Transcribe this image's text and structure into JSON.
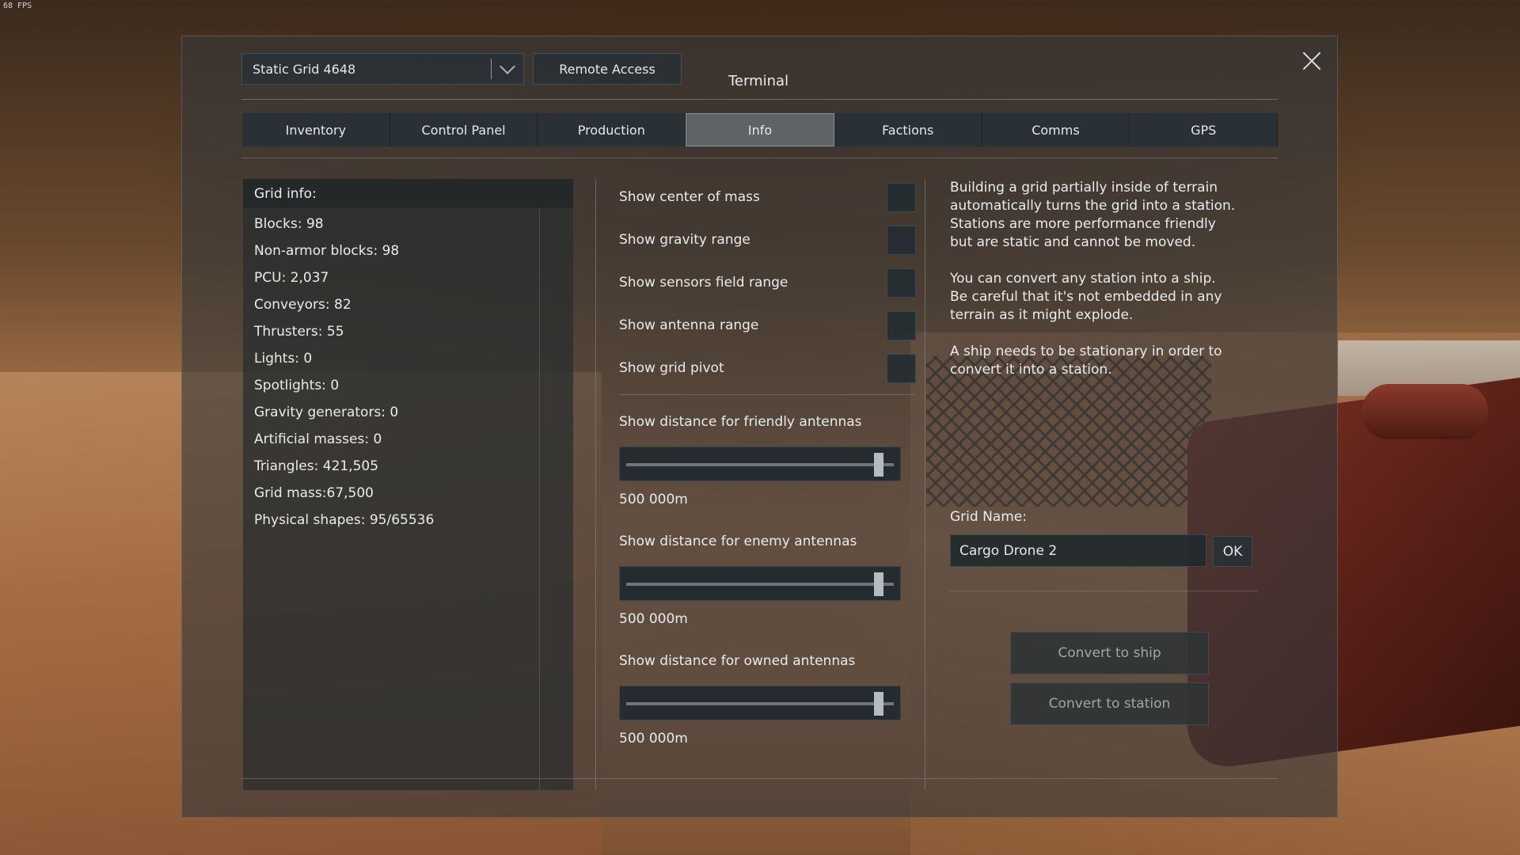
{
  "hud": {
    "fps": "68 FPS"
  },
  "terminal": {
    "title": "Terminal",
    "grid_selector": {
      "value": "Static Grid 4648"
    },
    "remote_access_label": "Remote Access",
    "close_icon": "close-icon"
  },
  "tabs": [
    {
      "label": "Inventory",
      "active": false
    },
    {
      "label": "Control Panel",
      "active": false
    },
    {
      "label": "Production",
      "active": false
    },
    {
      "label": "Info",
      "active": true
    },
    {
      "label": "Factions",
      "active": false
    },
    {
      "label": "Comms",
      "active": false
    },
    {
      "label": "GPS",
      "active": false
    }
  ],
  "grid_info": {
    "header": "Grid info:",
    "rows": [
      "Blocks: 98",
      "Non-armor blocks: 98",
      "PCU: 2,037",
      "Conveyors: 82",
      "Thrusters: 55",
      "Lights: 0",
      "Spotlights: 0",
      "Gravity generators: 0",
      "Artificial masses: 0",
      "Triangles: 421,505",
      "Grid mass:67,500",
      "Physical shapes: 95/65536"
    ]
  },
  "options": [
    {
      "label": "Show center of mass",
      "checked": false
    },
    {
      "label": "Show gravity range",
      "checked": false
    },
    {
      "label": "Show sensors field range",
      "checked": false
    },
    {
      "label": "Show antenna range",
      "checked": false
    },
    {
      "label": "Show grid pivot",
      "checked": false
    }
  ],
  "sliders": [
    {
      "label": "Show distance for friendly antennas",
      "value": "500 000m",
      "fraction": 0.96
    },
    {
      "label": "Show distance for enemy antennas",
      "value": "500 000m",
      "fraction": 0.96
    },
    {
      "label": "Show distance for owned antennas",
      "value": "500 000m",
      "fraction": 0.96
    }
  ],
  "description": [
    "Building a grid partially inside of terrain\nautomatically turns the grid into a station.\nStations are more performance friendly\nbut are static and cannot be moved.",
    "You can convert any station into a ship.\nBe careful that it's not embedded in any\nterrain as it might explode.",
    "A ship needs to be stationary in order to\nconvert it into a station."
  ],
  "grid_name": {
    "label": "Grid Name:",
    "value": "Cargo Drone 2",
    "ok_label": "OK"
  },
  "convert": {
    "to_ship_label": "Convert to ship",
    "to_station_label": "Convert to station"
  }
}
